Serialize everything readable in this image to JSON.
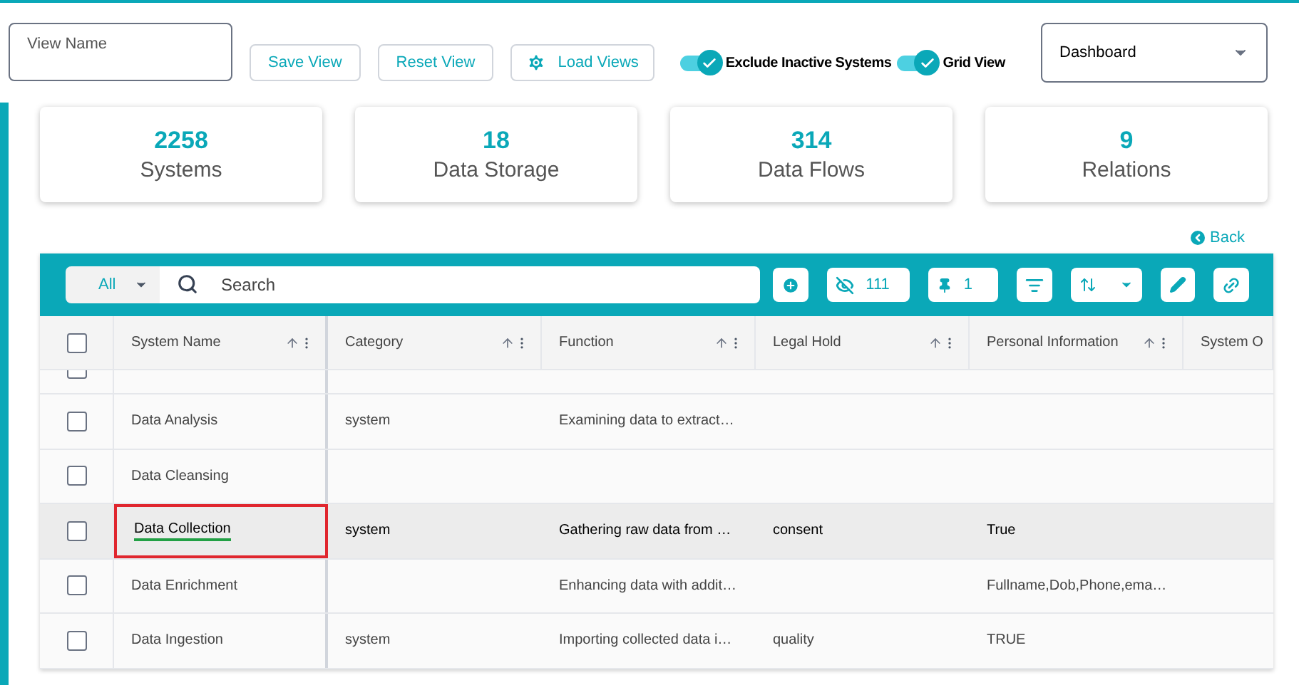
{
  "view_name": {
    "placeholder": "View Name"
  },
  "buttons": {
    "save": "Save View",
    "reset": "Reset View",
    "load": "Load Views"
  },
  "toggles": [
    {
      "label": "Exclude Inactive Systems",
      "on": true
    },
    {
      "label": "Grid View",
      "on": true
    }
  ],
  "dashboard_select": {
    "value": "Dashboard"
  },
  "stats": [
    {
      "value": "2258",
      "label": "Systems"
    },
    {
      "value": "18",
      "label": "Data Storage"
    },
    {
      "value": "314",
      "label": "Data Flows"
    },
    {
      "value": "9",
      "label": "Relations"
    }
  ],
  "back_link": "Back",
  "toolbar": {
    "filter": "All",
    "search": {
      "placeholder": "Search"
    },
    "hidden_count": "111",
    "pinned_count": "1"
  },
  "table": {
    "select_all": {
      "checked": false
    },
    "columns": [
      {
        "label": "System Name"
      },
      {
        "label": "Category"
      },
      {
        "label": "Function"
      },
      {
        "label": "Legal Hold"
      },
      {
        "label": "Personal Information"
      },
      {
        "label": "System O"
      }
    ],
    "cut_row": {
      "checked": false
    },
    "rows": [
      {
        "checked": false,
        "selected": false,
        "focused": false,
        "cells": [
          "Data Analysis",
          "system",
          "Examining data to extract…",
          "",
          ""
        ]
      },
      {
        "checked": false,
        "selected": false,
        "focused": false,
        "cells": [
          "Data Cleansing",
          "",
          "",
          "",
          ""
        ]
      },
      {
        "checked": false,
        "selected": true,
        "focused": true,
        "cells": [
          "Data Collection",
          "system",
          "Gathering raw data from …",
          "consent",
          "True"
        ]
      },
      {
        "checked": false,
        "selected": false,
        "focused": false,
        "cells": [
          "Data Enrichment",
          "",
          "Enhancing data with addit…",
          "",
          "Fullname,Dob,Phone,ema…"
        ]
      },
      {
        "checked": false,
        "selected": false,
        "focused": false,
        "cells": [
          "Data Ingestion",
          "system",
          "Importing collected data i…",
          "quality",
          "TRUE"
        ]
      }
    ]
  }
}
